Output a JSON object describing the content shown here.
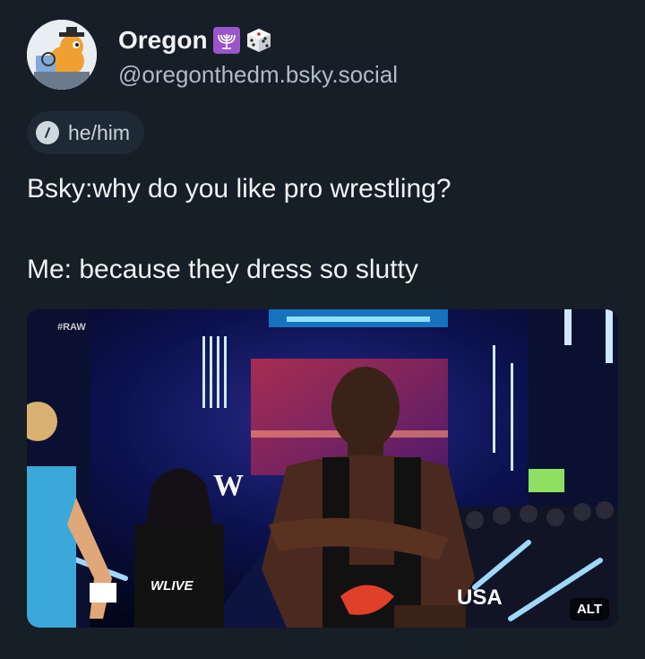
{
  "author": {
    "display_name": "Oregon",
    "handle": "@oregonthedm.bsky.social",
    "name_emojis": [
      "menorah-emoji",
      "dice-emoji"
    ]
  },
  "pronouns": {
    "label": "he/him",
    "icon": "pronoun-info-icon"
  },
  "post": {
    "line_1": "Bsky:why do you like pro wrestling?",
    "line_2": "Me: because they dress so slutty"
  },
  "media": {
    "type": "image",
    "overlay_texts": {
      "raw_tag": "#RAW",
      "shirt_text": "WLIVE",
      "network_logo": "USA",
      "wwe_logo": "W"
    },
    "alt_badge": "ALT"
  },
  "colors": {
    "background": "#161e27",
    "text_primary": "#f1f3f5",
    "text_secondary": "#aebbc9",
    "pill_background": "#1e2936"
  }
}
